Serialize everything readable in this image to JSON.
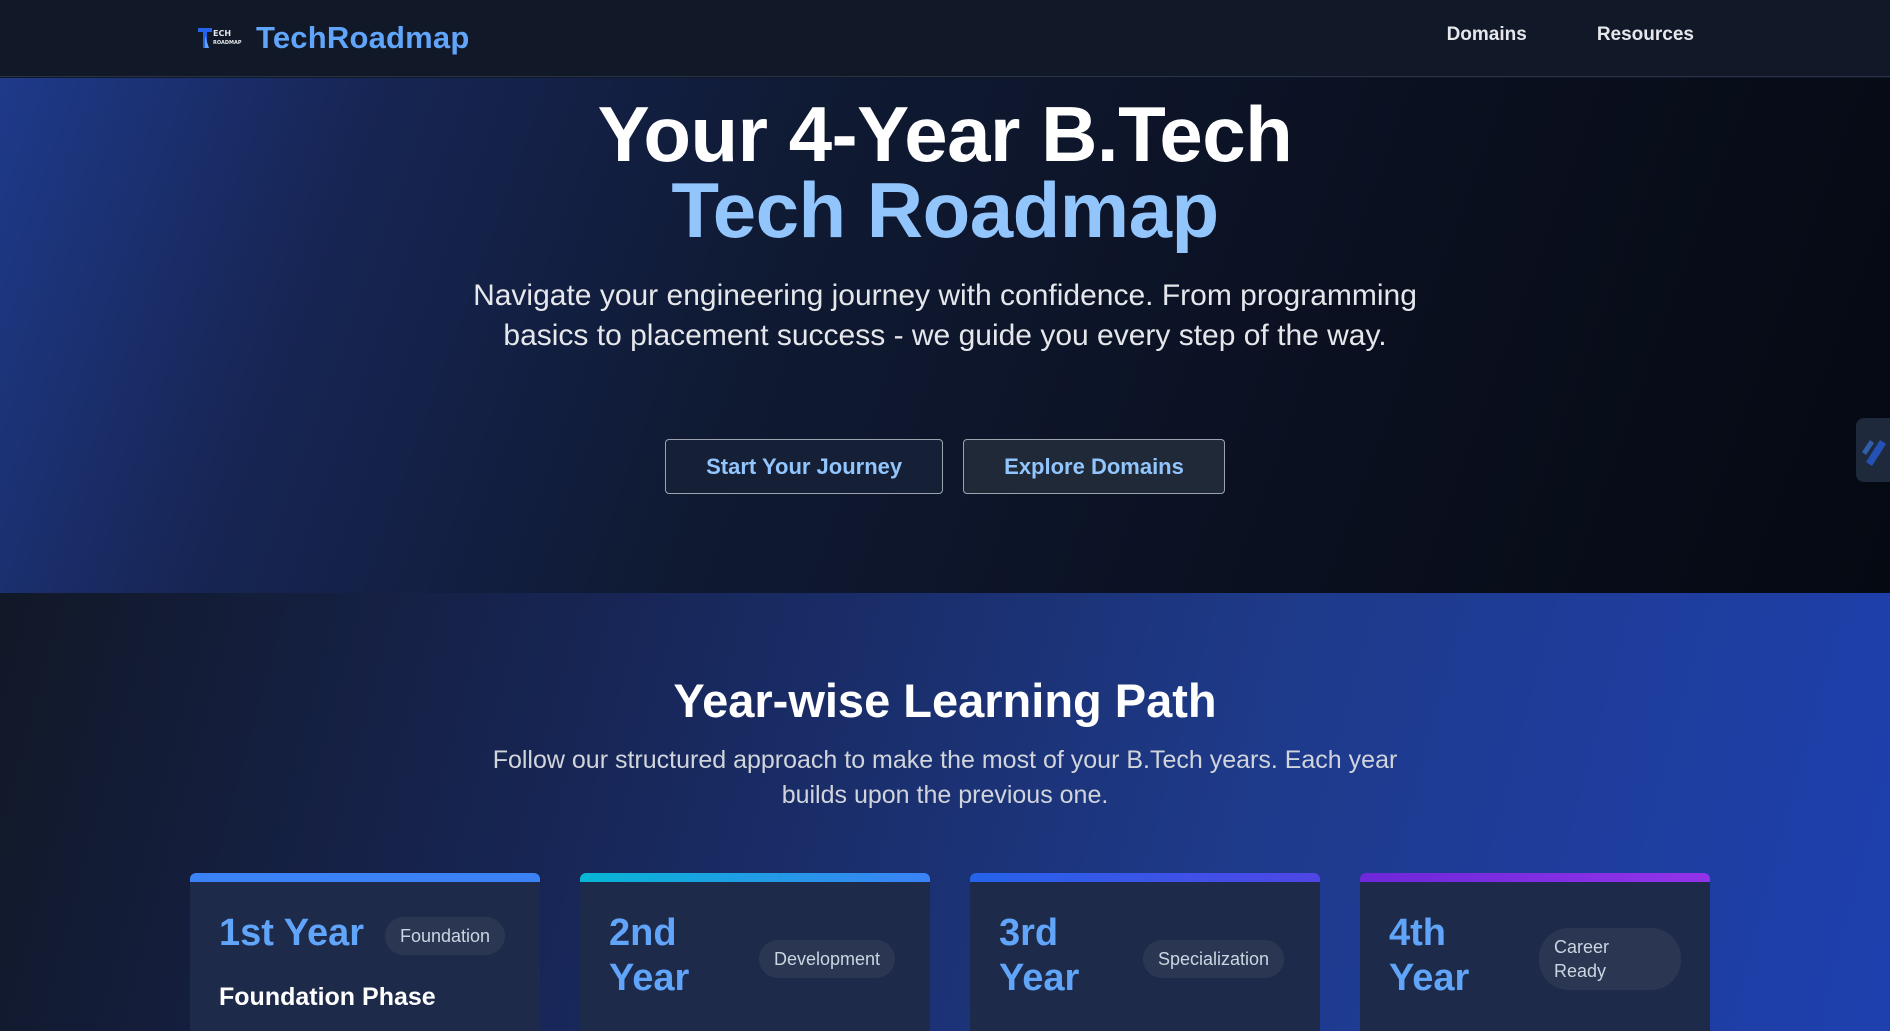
{
  "nav": {
    "brand": "TechRoadmap",
    "links": [
      "Domains",
      "Resources"
    ]
  },
  "hero": {
    "title_line1": "Your 4-Year B.Tech",
    "title_line2": "Tech Roadmap",
    "subtitle": "Navigate your engineering journey with confidence. From programming basics to placement success - we guide you every step of the way.",
    "primary_button": "Start Your Journey",
    "secondary_button": "Explore Domains"
  },
  "path": {
    "title": "Year-wise Learning Path",
    "subtitle": "Follow our structured approach to make the most of your B.Tech years. Each year builds upon the previous one.",
    "cards": [
      {
        "year": "1st Year",
        "badge": "Foundation",
        "phase": "Foundation Phase",
        "accent": "#3b82f6"
      },
      {
        "year": "2nd Year",
        "badge": "Development",
        "phase": "",
        "accent": "#06b6d4"
      },
      {
        "year": "3rd Year",
        "badge": "Specialization",
        "phase": "",
        "accent": "#4f46e5"
      },
      {
        "year": "4th Year",
        "badge": "Career Ready",
        "phase": "",
        "accent": "#9333ea"
      }
    ]
  },
  "colors": {
    "accent": "#60a5fa",
    "accent_light": "#93c5fd",
    "nav_bg": "#111827"
  }
}
